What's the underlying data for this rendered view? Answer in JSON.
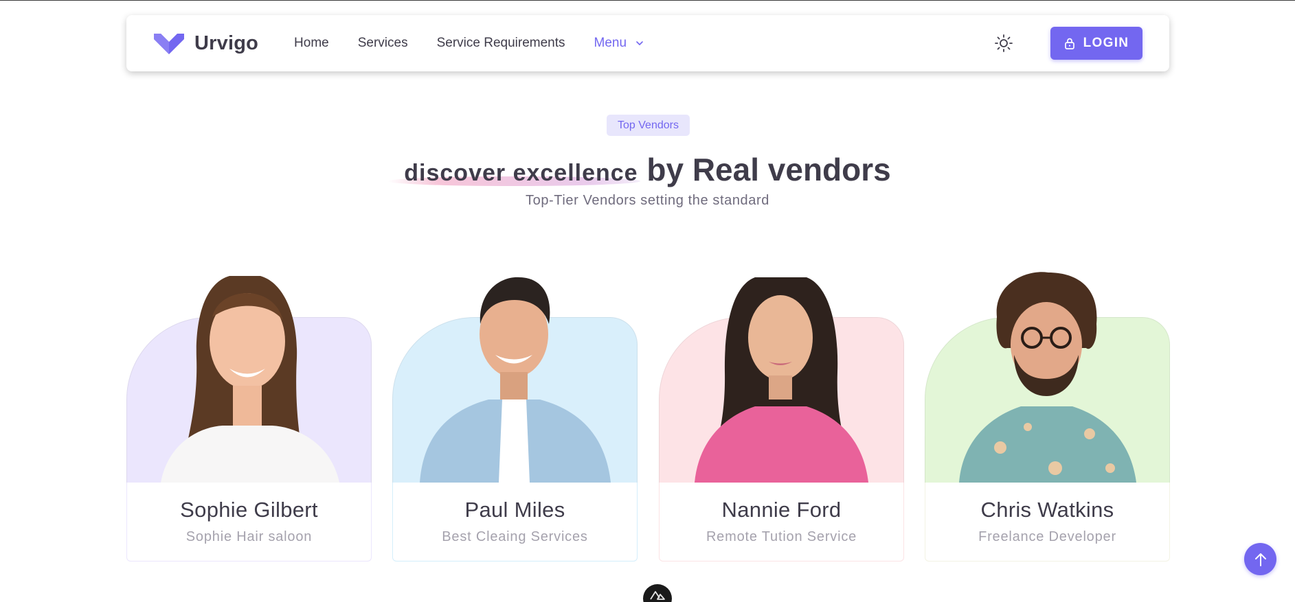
{
  "brand": {
    "name": "Urvigo",
    "color": "#7367f0"
  },
  "nav": {
    "items": [
      {
        "label": "Home"
      },
      {
        "label": "Services"
      },
      {
        "label": "Service Requirements"
      }
    ],
    "menu_label": "Menu",
    "theme_icon": "sun-icon",
    "login_label": "LOGIN",
    "login_icon": "lock-icon"
  },
  "section": {
    "badge": "Top Vendors",
    "headline_highlight": "discover excellence",
    "headline_rest": "by Real vendors",
    "subheading": "Top-Tier Vendors setting the standard"
  },
  "vendors": [
    {
      "name": "Sophie Gilbert",
      "service": "Sophie Hair saloon",
      "bg_color": "#ebe6fd",
      "border_color": "#ebe6fd"
    },
    {
      "name": "Paul Miles",
      "service": "Best Cleaing Services",
      "bg_color": "#d9effb",
      "border_color": "#d4eefb"
    },
    {
      "name": "Nannie Ford",
      "service": "Remote Tution Service",
      "bg_color": "#fde3e6",
      "border_color": "#fbe3e5"
    },
    {
      "name": "Chris Watkins",
      "service": "Freelance Developer",
      "bg_color": "#e3f6d7",
      "border_color": "#f3f3e4"
    }
  ],
  "floating": {
    "scroll_top_icon": "arrow-up-icon",
    "devtools_icon": "nuxt-devtools-icon"
  },
  "colors": {
    "primary": "#7367f0",
    "text": "#3f3c4a",
    "muted": "#a5a2ad"
  }
}
